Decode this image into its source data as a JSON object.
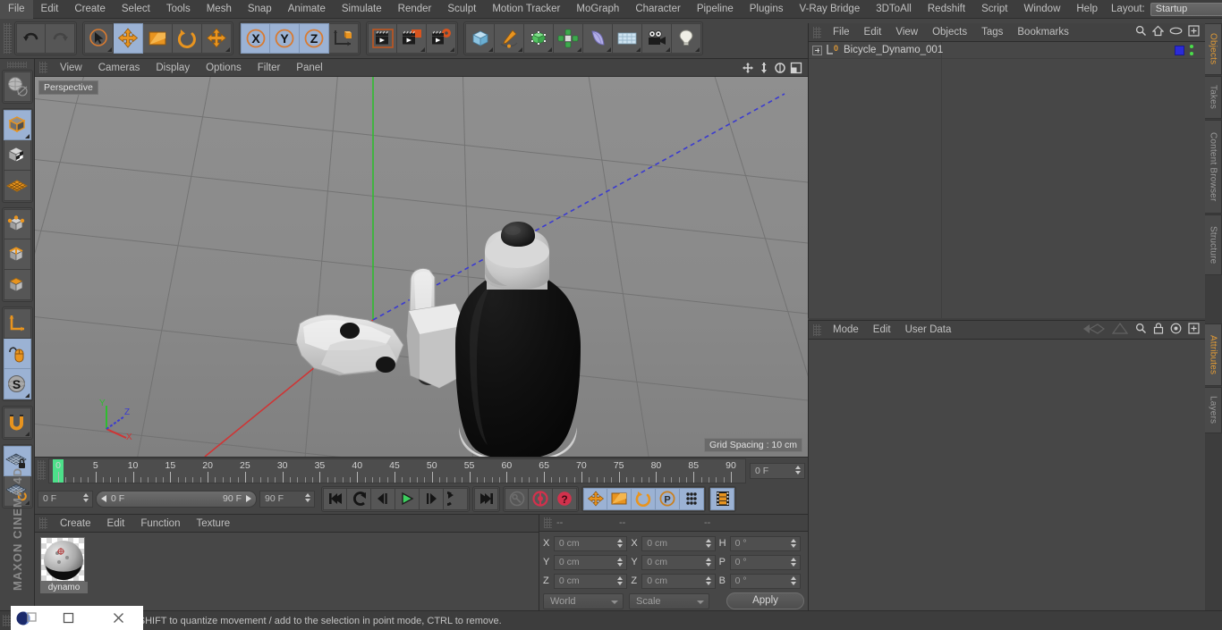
{
  "menubar": {
    "items": [
      "File",
      "Edit",
      "Create",
      "Select",
      "Tools",
      "Mesh",
      "Snap",
      "Animate",
      "Simulate",
      "Render",
      "Sculpt",
      "Motion Tracker",
      "MoGraph",
      "Character",
      "Pipeline",
      "Plugins",
      "V-Ray Bridge",
      "3DToAll",
      "Redshift",
      "Script",
      "Window",
      "Help"
    ],
    "layout_label": "Layout:",
    "layout_value": "Startup",
    "search_icon": "search-icon"
  },
  "toolbar": {
    "groups": [
      {
        "name": "undo-redo",
        "buttons": [
          {
            "name": "undo-button",
            "icon": "undo-arrow-icon",
            "active": false
          },
          {
            "name": "redo-button",
            "icon": "redo-arrow-icon",
            "active": false,
            "disabled": true
          }
        ]
      },
      {
        "name": "transform-tools",
        "buttons": [
          {
            "name": "live-selection-tool",
            "icon": "cursor-circle-icon",
            "active": false
          },
          {
            "name": "move-tool",
            "icon": "move-arrows-icon",
            "active": true
          },
          {
            "name": "scale-tool",
            "icon": "scale-box-icon",
            "active": false
          },
          {
            "name": "rotate-tool",
            "icon": "rotate-circle-icon",
            "active": false
          },
          {
            "name": "dynamic-place-tool",
            "icon": "move-arrows-icon",
            "active": false
          }
        ]
      },
      {
        "name": "axis-locks",
        "buttons": [
          {
            "name": "lock-x-axis-button",
            "icon": "x-axis-icon",
            "active": true
          },
          {
            "name": "lock-y-axis-button",
            "icon": "y-axis-icon",
            "active": true
          },
          {
            "name": "lock-z-axis-button",
            "icon": "z-axis-icon",
            "active": true
          },
          {
            "name": "world-object-coordinates-button",
            "icon": "world-axis-cube-icon",
            "active": false
          }
        ]
      },
      {
        "name": "render-tools",
        "buttons": [
          {
            "name": "render-view-button",
            "icon": "clapperboard-icon",
            "active": false
          },
          {
            "name": "render-to-picture-viewer-button",
            "icon": "clapperboard-window-icon",
            "active": false
          },
          {
            "name": "render-settings-button",
            "icon": "clapperboard-gear-icon",
            "active": false
          }
        ]
      },
      {
        "name": "object-creation",
        "buttons": [
          {
            "name": "add-cube-button",
            "icon": "blue-cube-icon",
            "active": false
          },
          {
            "name": "add-spline-button",
            "icon": "pen-spline-icon",
            "active": false
          },
          {
            "name": "add-nurbs-button",
            "icon": "green-cube-generator-icon",
            "active": false
          },
          {
            "name": "add-array-button",
            "icon": "green-cluster-icon",
            "active": false
          },
          {
            "name": "add-deformer-button",
            "icon": "purple-bend-icon",
            "active": false
          },
          {
            "name": "add-scene-button",
            "icon": "floor-grid-icon",
            "active": false
          },
          {
            "name": "add-camera-button",
            "icon": "camera-icon",
            "active": false
          },
          {
            "name": "add-light-button",
            "icon": "lightbulb-icon",
            "active": false
          }
        ]
      }
    ]
  },
  "left_toolbar": {
    "groups": [
      {
        "name": "undo-view",
        "buttons": [
          {
            "name": "undo-view-button",
            "icon": "globe-sphere-icon",
            "active": false
          }
        ]
      },
      {
        "name": "selection-modes",
        "buttons": [
          {
            "name": "make-editable-button",
            "icon": "editable-cube-icon",
            "active": true
          },
          {
            "name": "model-mode-button",
            "icon": "checker-cube-icon",
            "active": false
          },
          {
            "name": "texture-mode-button",
            "icon": "texture-plane-icon",
            "active": false
          }
        ]
      },
      {
        "name": "component-modes",
        "buttons": [
          {
            "name": "points-mode-button",
            "icon": "points-cube-icon",
            "active": false
          },
          {
            "name": "edges-mode-button",
            "icon": "edges-cube-icon",
            "active": false
          },
          {
            "name": "polygons-mode-button",
            "icon": "polygons-cube-icon",
            "active": false
          }
        ]
      },
      {
        "name": "axis-tools",
        "buttons": [
          {
            "name": "enable-axis-button",
            "icon": "axis-l-icon",
            "active": false
          },
          {
            "name": "viewport-solo-button",
            "icon": "mouse-icon",
            "active": true
          },
          {
            "name": "enable-snap-button",
            "icon": "s-sphere-icon",
            "active": true
          }
        ]
      },
      {
        "name": "magnet-group",
        "buttons": [
          {
            "name": "magnet-tool-button",
            "icon": "magnet-icon",
            "active": false
          }
        ]
      },
      {
        "name": "workplane-group",
        "buttons": [
          {
            "name": "lock-workplane-button",
            "icon": "workplane-lock-icon",
            "active": true
          },
          {
            "name": "align-workplane-button",
            "icon": "workplane-rotate-icon",
            "active": false
          }
        ]
      }
    ],
    "brand": "MAXON CINEMA 4D"
  },
  "viewport": {
    "menu": [
      "View",
      "Cameras",
      "Display",
      "Options",
      "Filter",
      "Panel"
    ],
    "nav_icons": [
      "pan-icon",
      "zoom-icon",
      "rotate-icon",
      "maximize-icon"
    ],
    "label": "Perspective",
    "grid_spacing": "Grid Spacing : 10 cm",
    "axis_labels": {
      "x": "X",
      "y": "Y",
      "z": "Z"
    }
  },
  "timeline": {
    "ruler_ticks": [
      0,
      5,
      10,
      15,
      20,
      25,
      30,
      35,
      40,
      45,
      50,
      55,
      60,
      65,
      70,
      75,
      80,
      85,
      90
    ],
    "current_frame_field": "0 F",
    "start_field": "0 F",
    "range_start": "0 F",
    "range_end": "90 F",
    "end_field": "90 F",
    "frame_spinner": "0 F",
    "playhead_frame": 0,
    "transport": [
      {
        "name": "go-to-start-button",
        "icon": "skip-start-icon",
        "active": false
      },
      {
        "name": "previous-key-button",
        "icon": "prev-key-icon",
        "active": false
      },
      {
        "name": "step-back-button",
        "icon": "step-back-icon",
        "active": false
      },
      {
        "name": "play-button",
        "icon": "play-icon",
        "active": false
      },
      {
        "name": "step-forward-button",
        "icon": "step-forward-icon",
        "active": false
      },
      {
        "name": "next-key-button",
        "icon": "next-key-icon",
        "active": false
      },
      {
        "name": "go-to-end-button",
        "icon": "skip-end-icon",
        "active": false
      }
    ],
    "record_group": [
      {
        "name": "record-active-objects-button",
        "icon": "key-icon",
        "active": false
      },
      {
        "name": "autokeying-button",
        "icon": "red-autokey-icon",
        "active": false
      },
      {
        "name": "keyframe-selection-button",
        "icon": "red-question-icon",
        "active": false
      }
    ],
    "key_group": [
      {
        "name": "record-position-button",
        "icon": "move-arrows-icon",
        "active": true
      },
      {
        "name": "record-scale-button",
        "icon": "scale-box-icon",
        "active": true
      },
      {
        "name": "record-rotation-button",
        "icon": "rotate-circle-icon",
        "active": true
      },
      {
        "name": "record-parameter-button",
        "icon": "p-circle-icon",
        "active": true
      },
      {
        "name": "record-pla-button",
        "icon": "point-dots-icon",
        "active": true
      }
    ],
    "dope_group": [
      {
        "name": "timeline-mode-button",
        "icon": "filmstrip-icon",
        "active": true
      }
    ]
  },
  "material_manager": {
    "menu": [
      "Create",
      "Edit",
      "Function",
      "Texture"
    ],
    "materials": [
      {
        "name": "dynamo"
      }
    ]
  },
  "coordinates": {
    "header_dashes": [
      "--",
      "--",
      "--"
    ],
    "rows": [
      {
        "pos_label": "X",
        "pos_value": "0 cm",
        "size_label": "X",
        "size_value": "0 cm",
        "rot_label": "H",
        "rot_value": "0 °"
      },
      {
        "pos_label": "Y",
        "pos_value": "0 cm",
        "size_label": "Y",
        "size_value": "0 cm",
        "rot_label": "P",
        "rot_value": "0 °"
      },
      {
        "pos_label": "Z",
        "pos_value": "0 cm",
        "size_label": "Z",
        "size_value": "0 cm",
        "rot_label": "B",
        "rot_value": "0 °"
      }
    ],
    "system_select": "World",
    "mode_select": "Scale",
    "apply_button": "Apply"
  },
  "object_manager": {
    "menu": [
      "File",
      "Edit",
      "View",
      "Objects",
      "Tags",
      "Bookmarks"
    ],
    "icons": [
      "search-icon",
      "home-icon",
      "eye-icon",
      "plus-box-icon"
    ],
    "objects": [
      {
        "name": "Bicycle_Dynamo_001",
        "layer_badge": "0",
        "tag_color": "#2b2bd8"
      }
    ]
  },
  "attributes_manager": {
    "menu": [
      "Mode",
      "Edit",
      "User Data"
    ],
    "icons": [
      "back-nav-icon",
      "forward-nav-icon",
      "search-icon",
      "lock-icon",
      "target-icon",
      "plus-box-icon"
    ]
  },
  "vertical_tabs": [
    {
      "label": "Objects",
      "active": true
    },
    {
      "label": "Takes",
      "active": false
    },
    {
      "label": "Content Browser",
      "active": false
    },
    {
      "label": "Structure",
      "active": false
    },
    {
      "label": "Attributes",
      "active": true
    },
    {
      "label": "Layers",
      "active": false
    }
  ],
  "statusbar": {
    "message": "move elements. Hold down SHIFT to quantize movement / add to the selection in point mode, CTRL to remove."
  },
  "taskbar": {
    "buttons": [
      "restore-icon",
      "minimize-icon",
      "close-icon"
    ]
  },
  "colors": {
    "accent_orange": "#e09a36",
    "active_blue": "#9bb2d4",
    "panel_bg": "#474747",
    "viewport_bg": "#8c8c8c",
    "green_playhead": "#4de08a"
  }
}
